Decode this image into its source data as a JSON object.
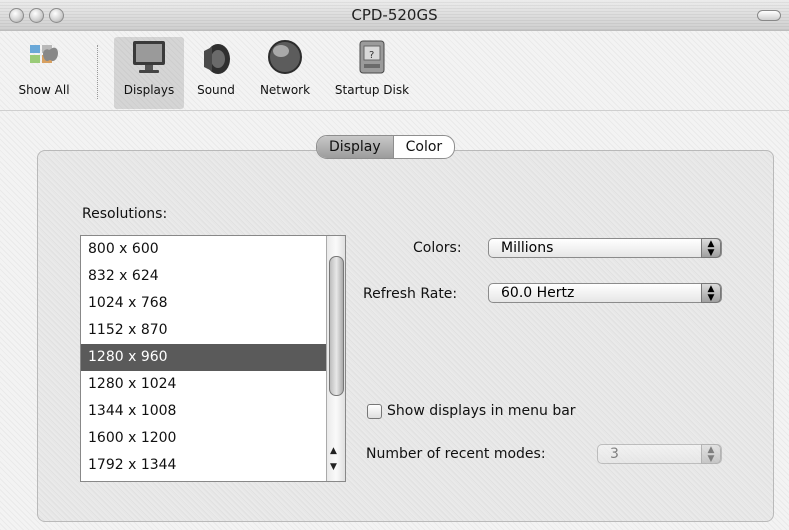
{
  "window": {
    "title": "CPD-520GS"
  },
  "toolbar": {
    "items": [
      {
        "label": "Show All",
        "icon": "apple-icon"
      },
      {
        "label": "Displays",
        "icon": "display-icon",
        "selected": true
      },
      {
        "label": "Sound",
        "icon": "speaker-icon"
      },
      {
        "label": "Network",
        "icon": "globe-icon"
      },
      {
        "label": "Startup Disk",
        "icon": "disk-icon"
      }
    ]
  },
  "tabs": [
    {
      "label": "Display",
      "active": true
    },
    {
      "label": "Color",
      "active": false
    }
  ],
  "resolutions": {
    "label": "Resolutions:",
    "items": [
      "800 x 600",
      "832 x 624",
      "1024 x 768",
      "1152 x 870",
      "1280 x 960",
      "1280 x 1024",
      "1344 x 1008",
      "1600 x 1200",
      "1792 x 1344"
    ],
    "selected": "1280 x 960"
  },
  "colors": {
    "label": "Colors:",
    "value": "Millions"
  },
  "refresh_rate": {
    "label": "Refresh Rate:",
    "value": "60.0 Hertz"
  },
  "show_displays": {
    "label": "Show displays in menu bar",
    "checked": false
  },
  "recent_modes": {
    "label": "Number of recent modes:",
    "value": "3",
    "enabled": false
  }
}
